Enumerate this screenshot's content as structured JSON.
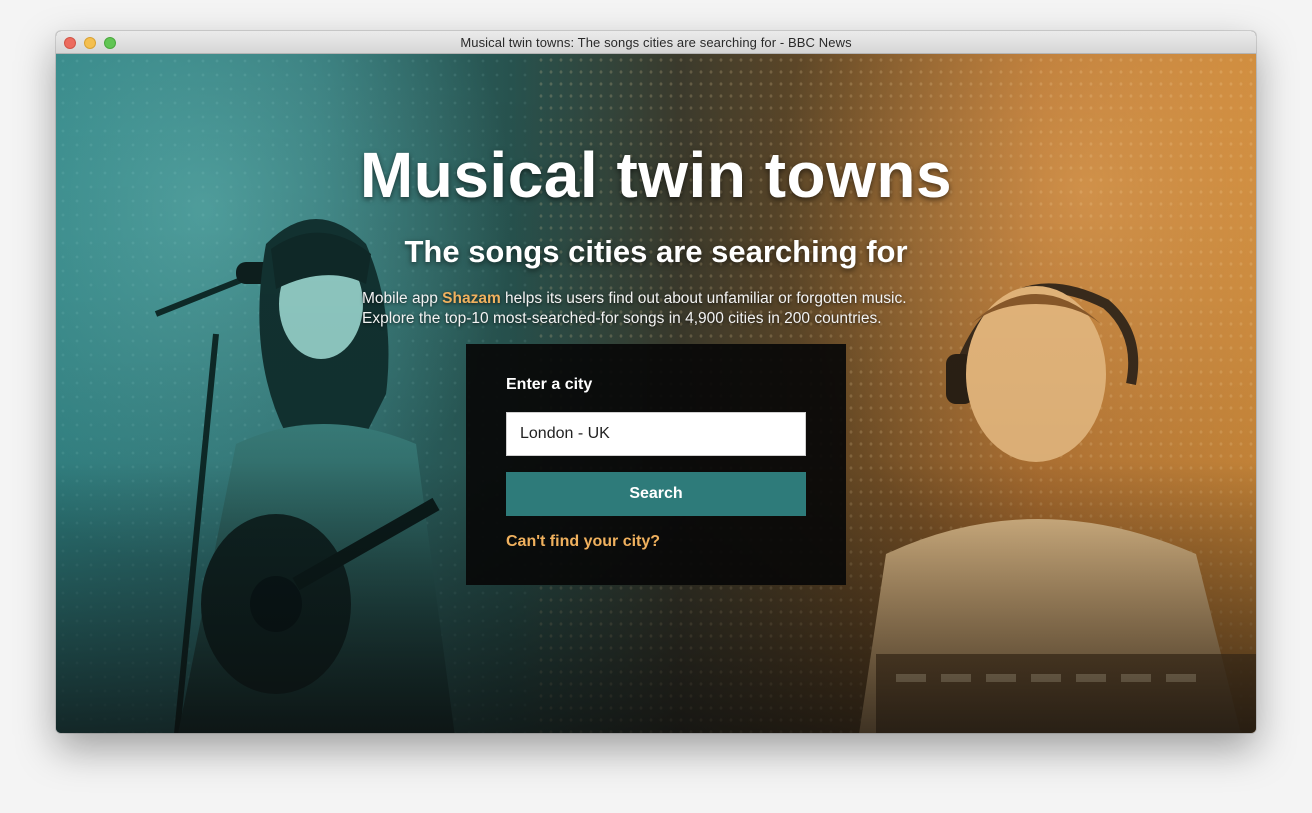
{
  "window": {
    "title": "Musical twin towns: The songs cities are searching for - BBC News"
  },
  "hero": {
    "headline": "Musical twin towns",
    "subheadline": "The songs cities are searching for",
    "intro_before": "Mobile app ",
    "intro_brand": "Shazam",
    "intro_after": " helps its users find out about unfamiliar or forgotten music.",
    "intro_line2": "Explore the top-10 most-searched-for songs in 4,900 cities in 200 countries."
  },
  "search": {
    "label": "Enter a city",
    "value": "London - UK",
    "button_label": "Search",
    "help_link": "Can't find your city?"
  },
  "colors": {
    "accent_teal": "#2e7b7a",
    "accent_orange": "#f0b15e",
    "panel_bg": "#080808"
  }
}
